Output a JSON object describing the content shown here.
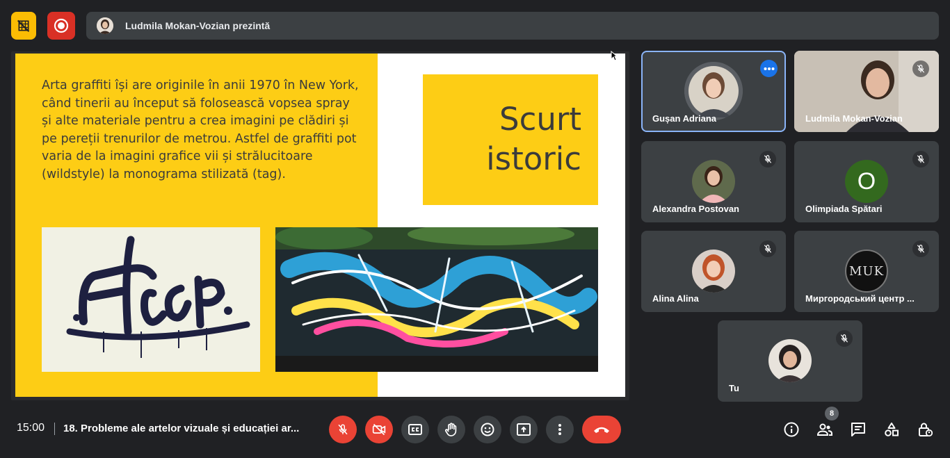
{
  "top_bar": {
    "presenter_text": "Ludmila Mokan-Vozian prezintă"
  },
  "slide": {
    "title_line1": "Scurt",
    "title_line2": "istoric",
    "body": "Arta graffiti își are originile în anii 1970 în New York, când tinerii au început să folosească vopsea spray și alte materiale pentru a crea imagini pe clădiri și pe pereții trenurilor de metrou. Astfel de graffiti pot varia de la imagini grafice vii și strălucitoare (wildstyle) la monograma stilizată (tag).",
    "colors": {
      "yellow": "#fdcd15",
      "text": "#3b3b3b"
    }
  },
  "participants": [
    {
      "name": "Gușan Adriana",
      "icon": "more-options-icon",
      "active_speaker": true
    },
    {
      "name": "Ludmila Mokan-Vozian",
      "icon": "mic-off-icon"
    },
    {
      "name": "Alexandra Postovan",
      "icon": "mic-off-icon"
    },
    {
      "name": "Olimpiada Spătari",
      "icon": "mic-off-icon",
      "initial": "O",
      "initial_color": "#33691e"
    },
    {
      "name": "Alina Alina",
      "icon": "mic-off-icon"
    },
    {
      "name": "Миргородський центр ...",
      "icon": "mic-off-icon",
      "avatar_text": "MUK"
    },
    {
      "name": "Tu",
      "icon": "mic-off-icon"
    }
  ],
  "bottom_bar": {
    "time": "15:00",
    "meeting_title": "18. Probleme ale artelor vizuale și educației ar...",
    "participant_count": "8",
    "colors": {
      "danger": "#ea4335",
      "control_bg": "#3c4043",
      "accent": "#8ab4f8"
    }
  }
}
